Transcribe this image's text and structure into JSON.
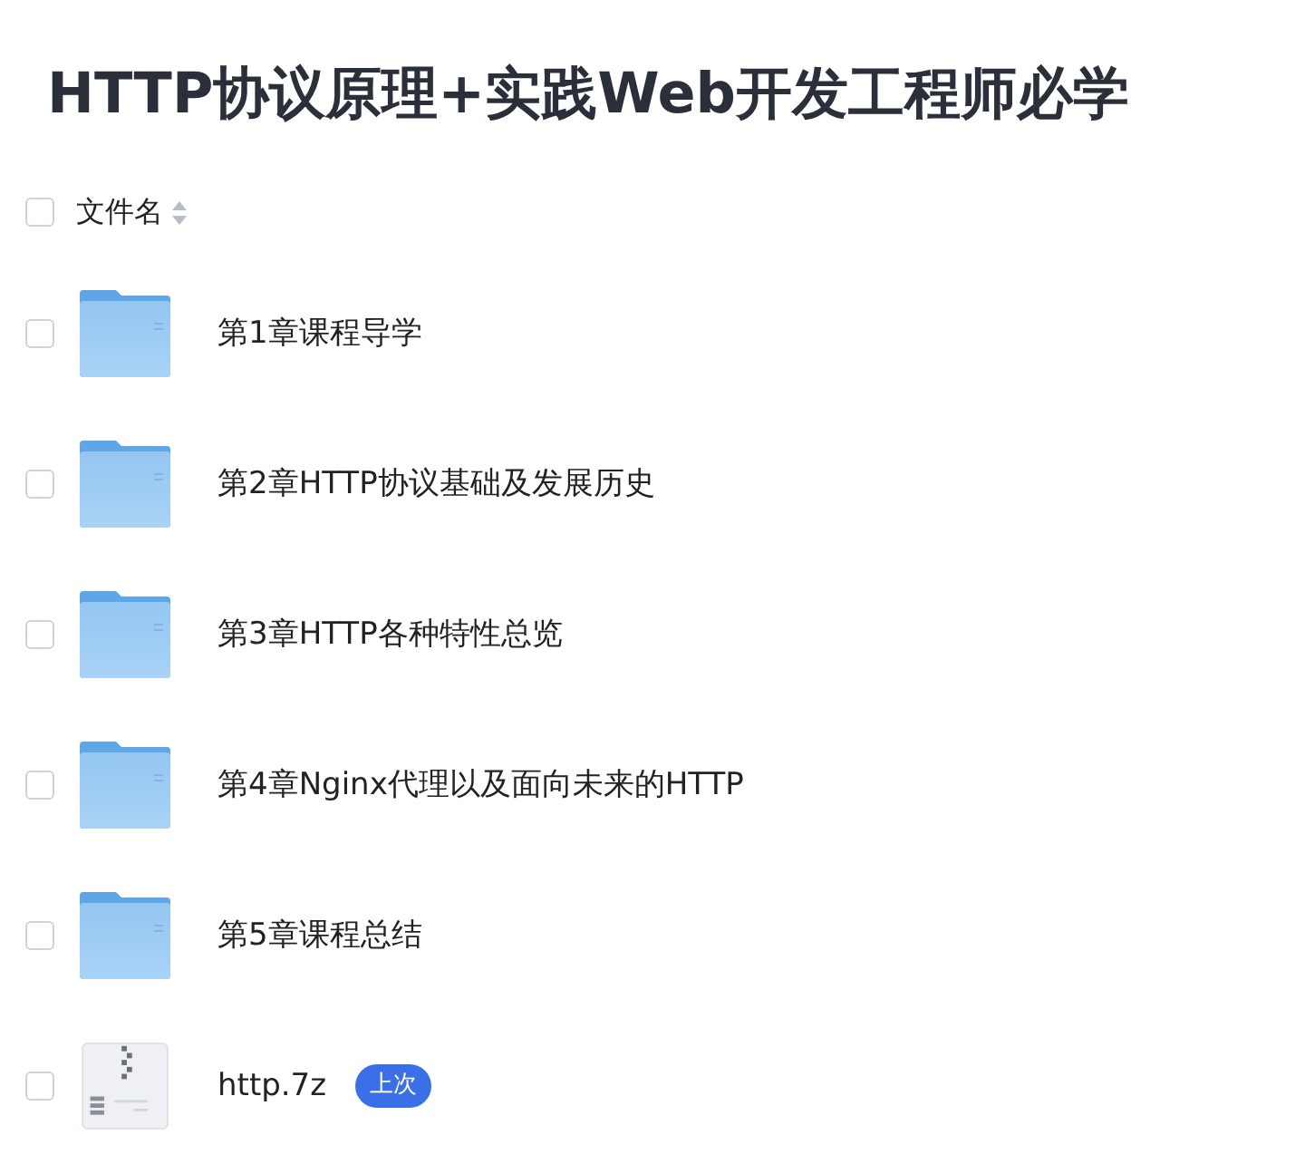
{
  "title": "HTTP协议原理+实践Web开发工程师必学",
  "header": {
    "checked": false,
    "column": "文件名"
  },
  "files": [
    {
      "kind": "folder",
      "name": "第1章课程导学",
      "checked": false
    },
    {
      "kind": "folder",
      "name": "第2章HTTP协议基础及发展历史",
      "checked": false
    },
    {
      "kind": "folder",
      "name": "第3章HTTP各种特性总览",
      "checked": false
    },
    {
      "kind": "folder",
      "name": "第4章Nginx代理以及面向未来的HTTP",
      "checked": false
    },
    {
      "kind": "folder",
      "name": "第5章课程总结",
      "checked": false
    },
    {
      "kind": "archive",
      "name": "http.7z",
      "checked": false,
      "badge": "上次"
    }
  ]
}
